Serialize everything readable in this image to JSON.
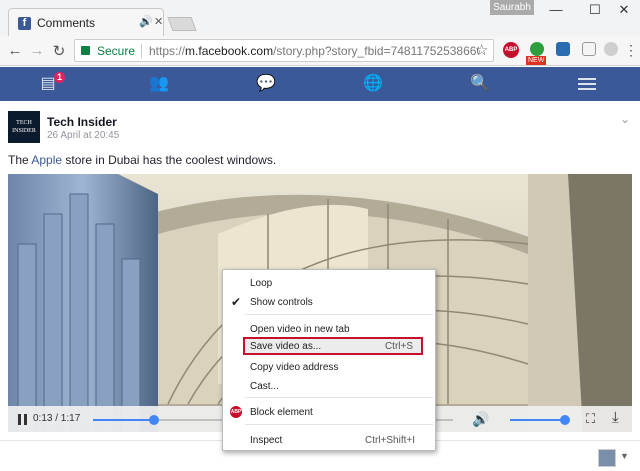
{
  "browser": {
    "tab_title": "Comments",
    "tab_favicon": "f",
    "profile_name": "Saurabh",
    "secure_label": "Secure",
    "url_scheme": "https://",
    "url_host": "m.facebook.com",
    "url_path": "/story.php?story_fbid=748117525386606",
    "ext_abp": "ABP",
    "ext_new_badge": "NEW"
  },
  "fb": {
    "notification_count": "1"
  },
  "post": {
    "page_name": "Tech Insider",
    "avatar_text": "TECH INSIDER",
    "date": "26 April at 20:45",
    "text_before": "The ",
    "link_text": "Apple",
    "text_after": " store in Dubai has the coolest windows."
  },
  "video": {
    "time": "0:13 / 1:17",
    "progress": 0.17,
    "volume": 0.95
  },
  "context_menu": {
    "items": [
      {
        "label": "Loop"
      },
      {
        "label": "Show controls",
        "checked": true
      },
      {
        "label": "Open video in new tab"
      },
      {
        "label": "Save video as...",
        "shortcut": "Ctrl+S",
        "highlighted": true
      },
      {
        "label": "Copy video address"
      },
      {
        "label": "Cast..."
      },
      {
        "label": "Block element",
        "icon": "ABP"
      },
      {
        "label": "Inspect",
        "shortcut": "Ctrl+Shift+I"
      }
    ]
  },
  "colors": {
    "fb_blue": "#3b5998",
    "secure_green": "#0b8043",
    "highlight_red": "#c8102e",
    "slider_blue": "#4285f4"
  }
}
